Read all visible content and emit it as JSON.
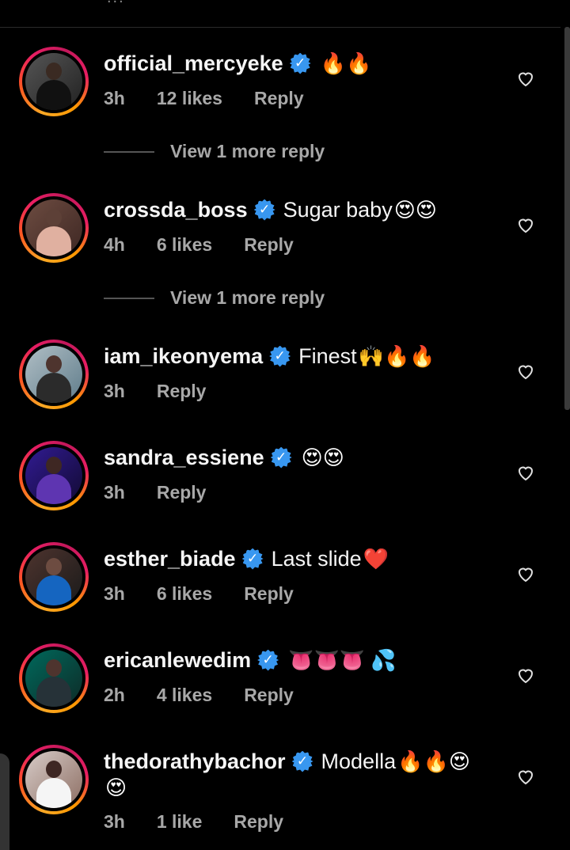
{
  "comments": [
    {
      "username": "official_mercyeke",
      "text": "",
      "emoji": "🔥🔥",
      "time": "3h",
      "likes": "12 likes",
      "reply": "Reply"
    },
    {
      "username": "crossda_boss",
      "text": "Sugar baby",
      "emoji": "😍😍",
      "time": "4h",
      "likes": "6 likes",
      "reply": "Reply"
    },
    {
      "username": "iam_ikeonyema",
      "text": "Finest",
      "emoji": "🙌🔥🔥",
      "time": "3h",
      "likes": "",
      "reply": "Reply"
    },
    {
      "username": "sandra_essiene",
      "text": "",
      "emoji": "😍😍",
      "time": "3h",
      "likes": "",
      "reply": "Reply"
    },
    {
      "username": "esther_biade",
      "text": "Last slide",
      "emoji": "❤️",
      "time": "3h",
      "likes": "6 likes",
      "reply": "Reply"
    },
    {
      "username": "ericanlewedim",
      "text": "",
      "emoji": "👅👅👅 💦",
      "time": "2h",
      "likes": "4 likes",
      "reply": "Reply"
    },
    {
      "username": "thedorathybachor",
      "text": "Modella",
      "emoji": "🔥🔥😍",
      "emoji_line2": "😍",
      "time": "3h",
      "likes": "1 like",
      "reply": "Reply"
    }
  ],
  "view_more": [
    "View 1 more reply",
    "View 1 more reply"
  ],
  "colors": {
    "background": "#000000",
    "verified": "#3897f0",
    "meta_text": "#a8a8a8"
  },
  "icons": {
    "verified": "verified-badge-icon",
    "like": "heart-outline-icon"
  }
}
